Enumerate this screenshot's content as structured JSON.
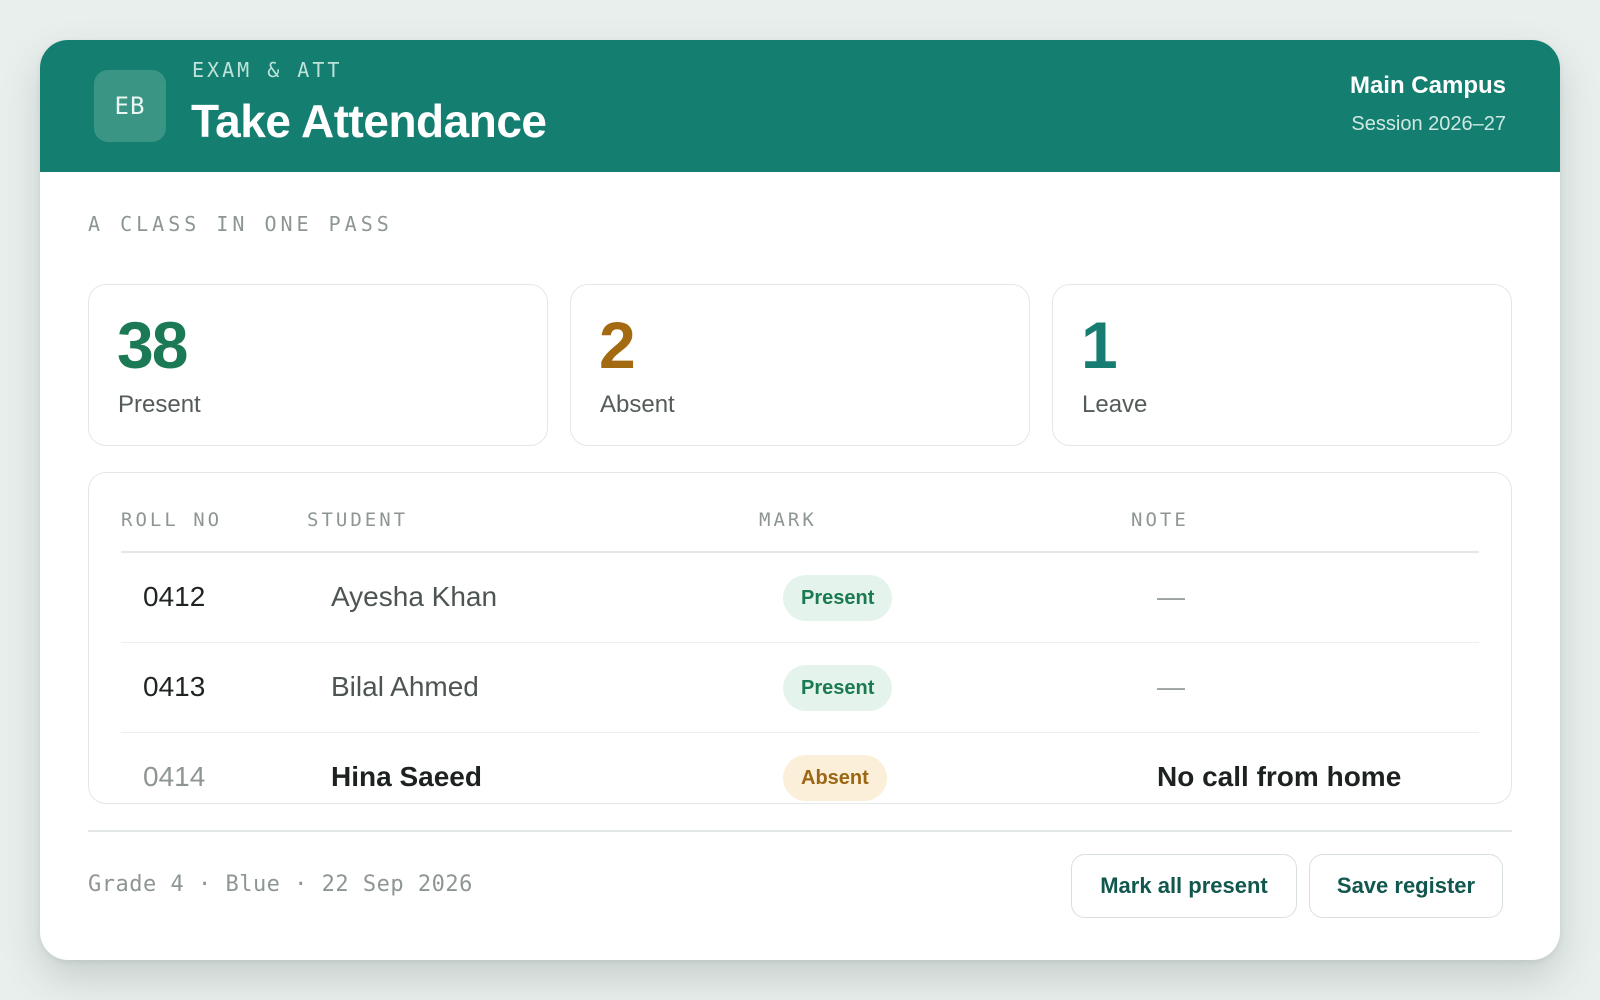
{
  "header": {
    "avatar_initials": "EB",
    "module_label": "EXAM & ATT",
    "title": "Take Attendance",
    "campus": "Main Campus",
    "session": "Session 2026–27",
    "color": "#147f70"
  },
  "eyebrow": "A CLASS IN ONE PASS",
  "stats": [
    {
      "value": "38",
      "label": "Present",
      "color": "#1b7a55"
    },
    {
      "value": "2",
      "label": "Absent",
      "color": "#a46a12"
    },
    {
      "value": "1",
      "label": "Leave",
      "color": "#177d72"
    }
  ],
  "table": {
    "columns": [
      "ROLL NO",
      "STUDENT",
      "MARK",
      "NOTE"
    ],
    "rows": [
      {
        "roll": "0412",
        "student": "Ayesha Khan",
        "mark": "Present",
        "note": "—"
      },
      {
        "roll": "0413",
        "student": "Bilal Ahmed",
        "mark": "Present",
        "note": "—"
      },
      {
        "roll": "0414",
        "student": "Hina Saeed",
        "mark": "Absent",
        "note": "No call from home"
      }
    ]
  },
  "footer": {
    "meta": "Grade 4 · Blue · 22 Sep 2026",
    "mark_all_label": "Mark all present",
    "save_label": "Save register"
  }
}
